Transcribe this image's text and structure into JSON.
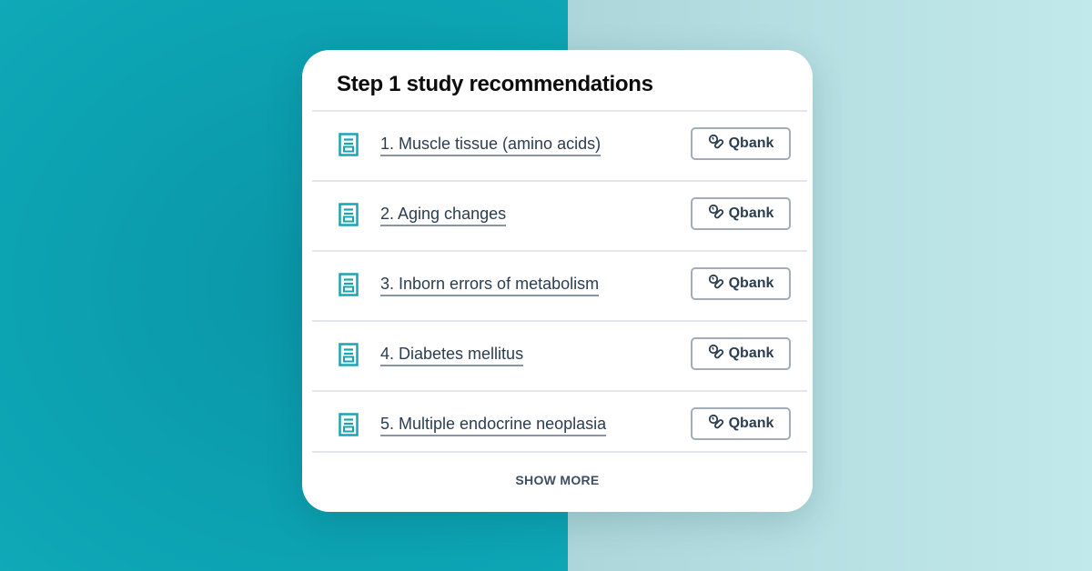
{
  "background": {
    "left_color": "#0ca3b3",
    "right_color": "#b4dde0"
  },
  "card": {
    "title": "Step 1 study recommendations",
    "items": [
      {
        "label": "1. Muscle tissue (amino acids)",
        "icon": "document-icon",
        "button_label": "Qbank",
        "button_icon": "qbank-pill-icon"
      },
      {
        "label": "2. Aging changes",
        "icon": "document-icon",
        "button_label": "Qbank",
        "button_icon": "qbank-pill-icon"
      },
      {
        "label": "3. Inborn errors of metabolism",
        "icon": "document-icon",
        "button_label": "Qbank",
        "button_icon": "qbank-pill-icon"
      },
      {
        "label": "4. Diabetes mellitus",
        "icon": "document-icon",
        "button_label": "Qbank",
        "button_icon": "qbank-pill-icon"
      },
      {
        "label": "5. Multiple endocrine neoplasia",
        "icon": "document-icon",
        "button_label": "Qbank",
        "button_icon": "qbank-pill-icon"
      }
    ],
    "show_more_label": "SHOW MORE"
  },
  "colors": {
    "accent": "#1aa3b3",
    "text": "#2b3d50"
  }
}
